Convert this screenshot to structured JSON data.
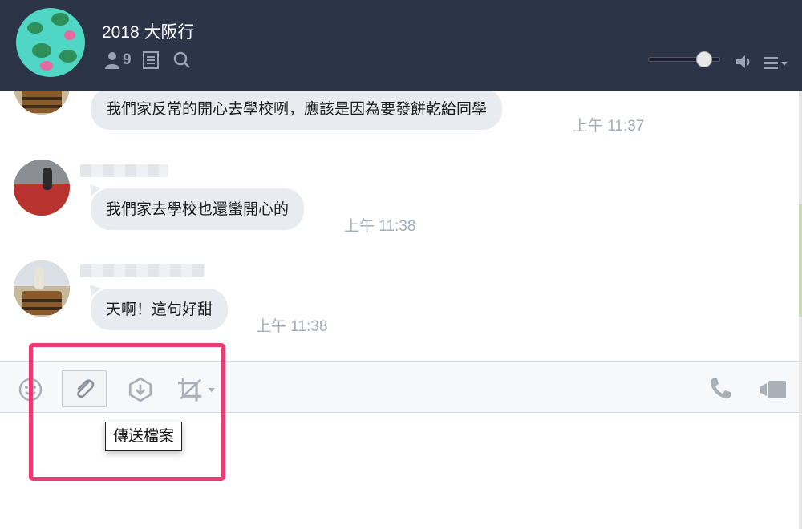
{
  "header": {
    "group_title": "2018 大阪行",
    "member_count": "9",
    "icons": [
      "members-icon",
      "notes-icon",
      "search-icon",
      "volume-slider",
      "speaker-icon",
      "menu-icon"
    ],
    "volume_level": 0.78,
    "background_color": "#2c3448"
  },
  "messages": [
    {
      "text": "我們家反常的開心去學校咧，應該是因為要發餅乾給同學",
      "time": "上午 11:37"
    },
    {
      "text": "我們家去學校也還蠻開心的",
      "time": "上午 11:38"
    },
    {
      "text": "天啊！這句好甜",
      "time": "上午 11:38"
    }
  ],
  "toolbar": {
    "icons": [
      "emoji-icon",
      "attach-file-icon",
      "keep-save-icon",
      "screenshot-crop-icon",
      "voice-call-icon",
      "video-call-icon"
    ],
    "tooltip": "傳送檔案"
  },
  "colors": {
    "bubble": "#e8ebef",
    "timestamp": "#a5adba",
    "highlight": "#ee3a72"
  }
}
